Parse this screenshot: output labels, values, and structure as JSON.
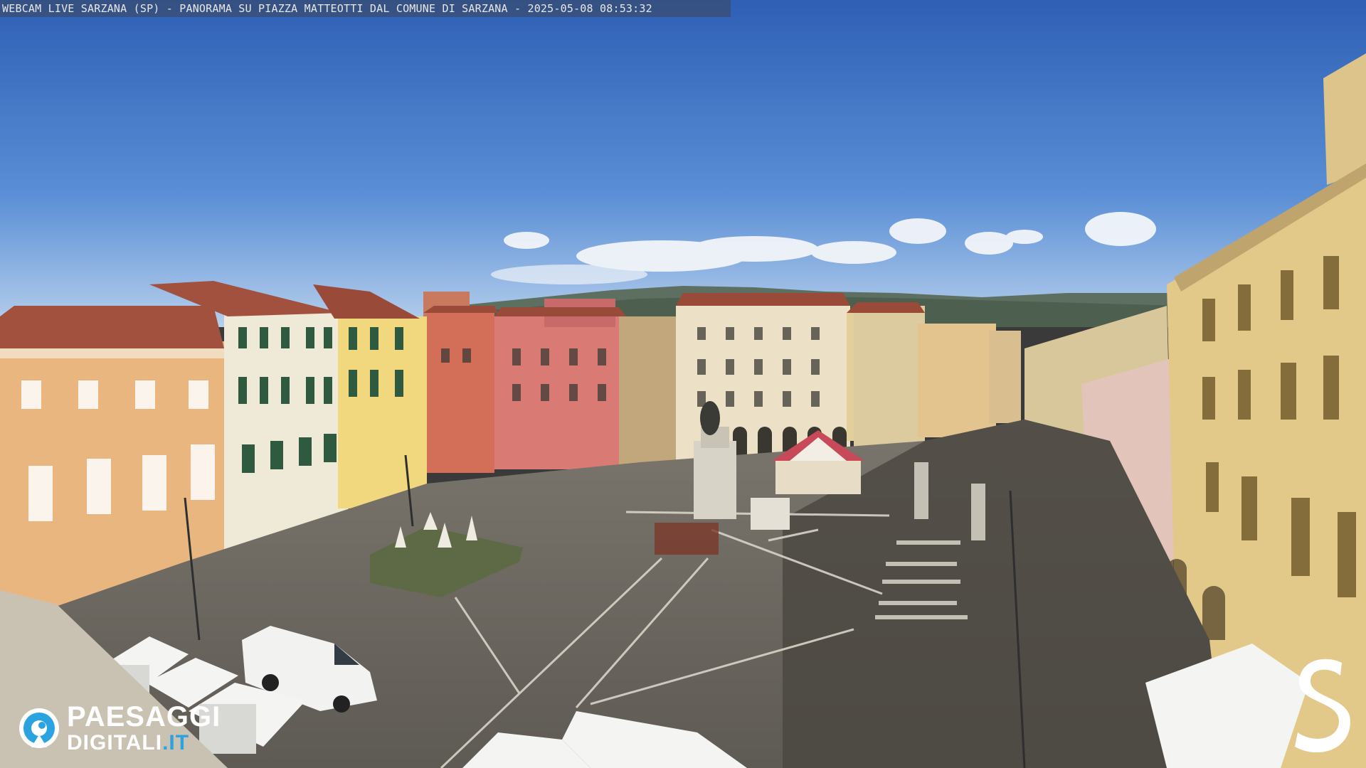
{
  "overlay": {
    "caption": "WEBCAM LIVE SARZANA (SP) - PANORAMA SU PIAZZA MATTEOTTI DAL COMUNE DI SARZANA - 2025-05-08  08:53:32"
  },
  "brand": {
    "line1": "PAESAGGI",
    "line2_main": "DIGITALI",
    "line2_tld": ".IT",
    "icon": "eye-icon"
  },
  "corner_logo": {
    "icon": "s-logo-icon"
  },
  "colors": {
    "sky_top": "#2f63b8",
    "sky_bottom": "#a9c6ea",
    "pavement": "#6f6a63",
    "brand_accent": "#2aa3e0"
  }
}
